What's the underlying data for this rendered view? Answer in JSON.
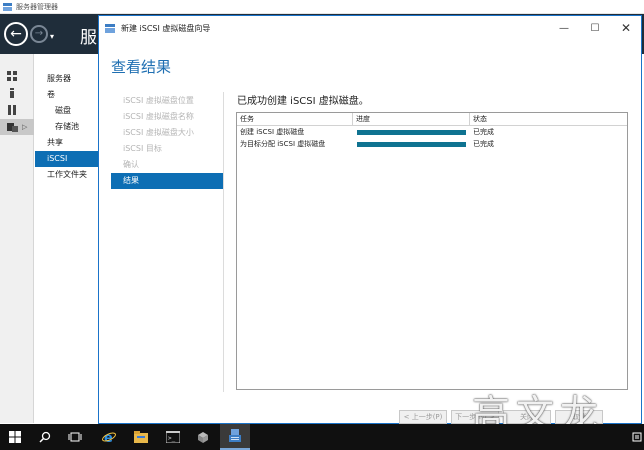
{
  "app": {
    "title": "服务器管理器",
    "header_title": "服"
  },
  "nav": {
    "back_label": "←",
    "forward_label": "→",
    "items": [
      {
        "label": "服务器",
        "sub": false,
        "active": false
      },
      {
        "label": "卷",
        "sub": false,
        "active": false
      },
      {
        "label": "磁盘",
        "sub": true,
        "active": false
      },
      {
        "label": "存储池",
        "sub": true,
        "active": false
      },
      {
        "label": "共享",
        "sub": false,
        "active": false
      },
      {
        "label": "iSCSI",
        "sub": false,
        "active": true
      },
      {
        "label": "工作文件夹",
        "sub": false,
        "active": false
      }
    ]
  },
  "wizard": {
    "title": "新建 iSCSI 虚拟磁盘向导",
    "heading": "查看结果",
    "steps": [
      {
        "label": "iSCSI 虚拟磁盘位置",
        "active": false
      },
      {
        "label": "iSCSI 虚拟磁盘名称",
        "active": false
      },
      {
        "label": "iSCSI 虚拟磁盘大小",
        "active": false
      },
      {
        "label": "iSCSI 目标",
        "active": false
      },
      {
        "label": "确认",
        "active": false
      },
      {
        "label": "结果",
        "active": true
      }
    ],
    "message": "已成功创建 iSCSI 虚拟磁盘。",
    "table": {
      "columns": [
        "任务",
        "进度",
        "状态"
      ],
      "rows": [
        {
          "task": "创建 iSCSI 虚拟磁盘",
          "progress": 1.0,
          "status": "已完成"
        },
        {
          "task": "为目标分配 iSCSI 虚拟磁盘",
          "progress": 1.0,
          "status": "已完成"
        }
      ]
    },
    "buttons": {
      "prev": "< 上一步(P)",
      "next": "下一步(N) >",
      "close": "关闭",
      "cancel": "取消"
    },
    "accent_color": "#1f6fb2",
    "progress_color": "#0f7391"
  },
  "watermark": "高文龙",
  "taskbar": {
    "items": [
      "windows-logo-icon",
      "search-icon",
      "task-view-icon",
      "internet-explorer-icon",
      "file-explorer-icon",
      "command-prompt-icon",
      "server-drive-icon",
      "server-manager-icon"
    ]
  }
}
